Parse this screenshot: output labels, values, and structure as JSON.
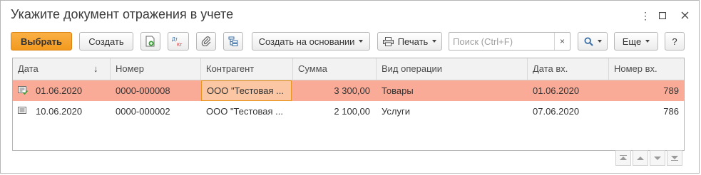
{
  "window": {
    "title": "Укажите документ отражения в учете",
    "more_icon": "kebab-menu-icon",
    "maximize_icon": "maximize-icon",
    "close_icon": "close-icon"
  },
  "toolbar": {
    "select_label": "Выбрать",
    "create_label": "Создать",
    "create_based_on_label": "Создать на основании",
    "print_label": "Печать",
    "search_placeholder": "Поиск (Ctrl+F)",
    "search_value": "",
    "clear_label": "×",
    "more_label": "Еще",
    "help_label": "?"
  },
  "table": {
    "columns": [
      "Дата",
      "Номер",
      "Контрагент",
      "Сумма",
      "Вид операции",
      "Дата вх.",
      "Номер вх."
    ],
    "sort_indicator": "↓",
    "rows": [
      {
        "icon": "document-posted-icon",
        "date": "01.06.2020",
        "number": "0000-000008",
        "counterparty": "ООО \"Тестовая ...",
        "amount": "3 300,00",
        "operation": "Товары",
        "incoming_date": "01.06.2020",
        "incoming_number": "789"
      },
      {
        "icon": "document-icon",
        "date": "10.06.2020",
        "number": "0000-000002",
        "counterparty": "ООО \"Тестовая ...",
        "amount": "2 100,00",
        "operation": "Услуги",
        "incoming_date": "07.06.2020",
        "incoming_number": "786"
      }
    ]
  },
  "colors": {
    "accent": "#f29a1e",
    "selected_row": "#f9ab97",
    "focused_cell_border": "#e8931d"
  }
}
